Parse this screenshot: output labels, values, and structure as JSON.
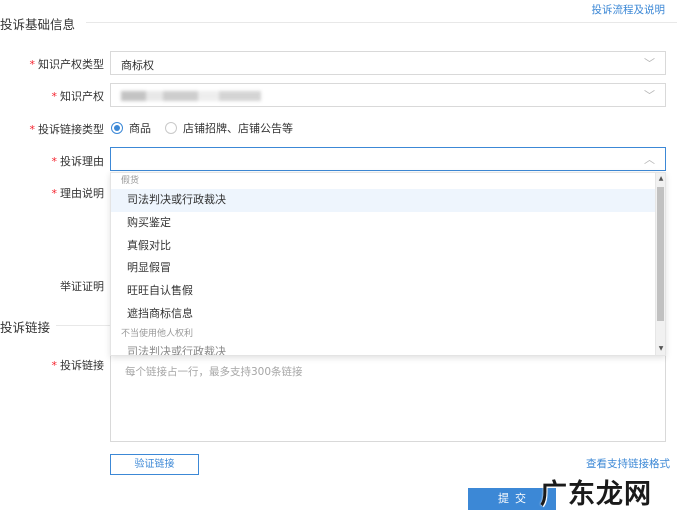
{
  "header": {
    "section_basic_title": "投诉基础信息",
    "help_link": "投诉流程及说明"
  },
  "form": {
    "ip_type": {
      "label": "知识产权类型",
      "value": "商标权"
    },
    "ip": {
      "label": "知识产权"
    },
    "link_type": {
      "label": "投诉链接类型",
      "options": [
        {
          "label": "商品",
          "selected": true
        },
        {
          "label": "店铺招牌、店铺公告等",
          "selected": false
        }
      ]
    },
    "reason": {
      "label": "投诉理由",
      "value": ""
    },
    "reason_desc": {
      "label": "理由说明"
    },
    "evidence": {
      "label": "举证证明"
    }
  },
  "dropdown": {
    "group1": "假货",
    "items": [
      "司法判决或行政裁决",
      "购买鉴定",
      "真假对比",
      "明显假冒",
      "旺旺自认售假",
      "遮挡商标信息"
    ],
    "group2": "不当使用他人权利",
    "partial_item": "司法判决或行政裁决"
  },
  "links": {
    "section_title": "投诉链接",
    "label": "投诉链接",
    "placeholder": "每个链接占一行，最多支持300条链接",
    "verify_button": "验证链接",
    "view_supported": "查看支持链接格式"
  },
  "submit_label": "提交",
  "watermark": "广东龙网",
  "colors": {
    "accent": "#3c88d6",
    "required": "#f5222d",
    "hover": "#eef5fd"
  }
}
